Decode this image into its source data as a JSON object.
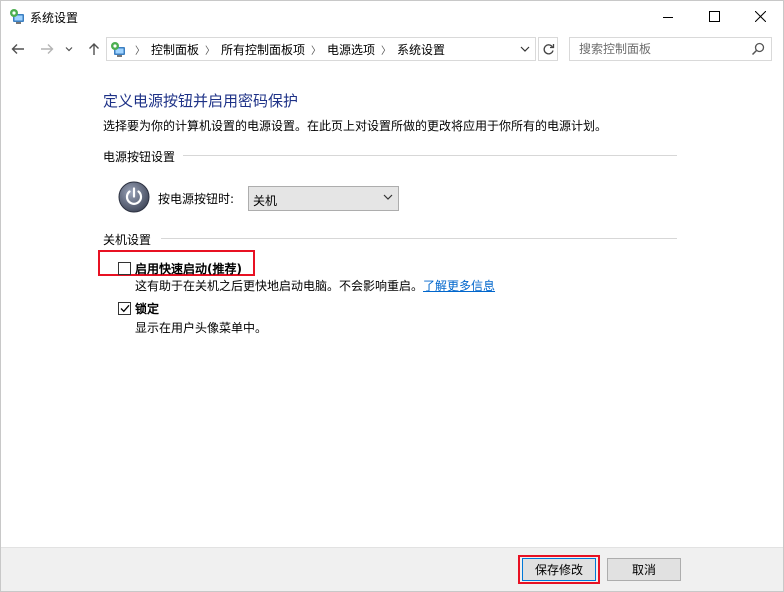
{
  "window": {
    "title": "系统设置"
  },
  "nav": {
    "breadcrumbs": [
      "控制面板",
      "所有控制面板项",
      "电源选项",
      "系统设置"
    ],
    "search_placeholder": "搜索控制面板"
  },
  "page": {
    "heading": "定义电源按钮并启用密码保护",
    "description": "选择要为你的计算机设置的电源设置。在此页上对设置所做的更改将应用于你所有的电源计划。",
    "power_section": {
      "title": "电源按钮设置",
      "label": "按电源按钮时:",
      "selected_value": "关机"
    },
    "shutdown_section": {
      "title": "关机设置",
      "fast_startup": {
        "label": "启用快速启动(推荐)",
        "checked": false,
        "description": "这有助于在关机之后更快地启动电脑。不会影响重启。",
        "link": "了解更多信息"
      },
      "lock": {
        "label": "锁定",
        "checked": true,
        "description": "显示在用户头像菜单中。"
      }
    }
  },
  "footer": {
    "save_label": "保存修改",
    "cancel_label": "取消"
  },
  "colors": {
    "heading": "#1e3287",
    "link": "#0066cc",
    "highlight": "#e81123",
    "footer_bg": "#f0f0f0"
  },
  "icons": {
    "app": "control-panel-icon",
    "back": "back-arrow-icon",
    "forward": "forward-arrow-icon",
    "recent": "chevron-down-icon",
    "up": "up-arrow-icon",
    "refresh": "refresh-icon",
    "search": "search-icon",
    "power": "power-icon"
  }
}
